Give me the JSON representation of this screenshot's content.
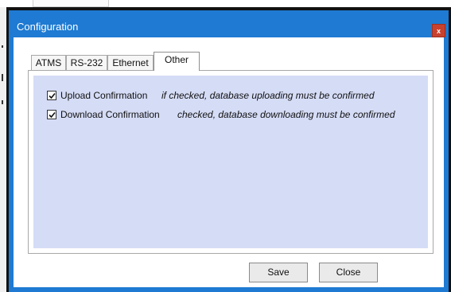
{
  "dialog": {
    "title": "Configuration",
    "close_glyph": "x",
    "tabs": [
      {
        "label": "ATMS"
      },
      {
        "label": "RS-232"
      },
      {
        "label": "Ethernet"
      },
      {
        "label": "Other",
        "selected": true
      }
    ],
    "options": [
      {
        "label": "Upload Confirmation",
        "checked": true,
        "description": "if checked, database uploading must be confirmed"
      },
      {
        "label": "Download Confirmation",
        "checked": true,
        "description": "checked, database downloading must be confirmed"
      }
    ],
    "buttons": {
      "save_label": "Save",
      "close_label": "Close"
    }
  },
  "colors": {
    "titlebar": "#1e7ad2",
    "panel": "#d5dcf6",
    "close_button": "#c8412f"
  },
  "icons": [
    "close-icon",
    "checkmark-icon"
  ]
}
